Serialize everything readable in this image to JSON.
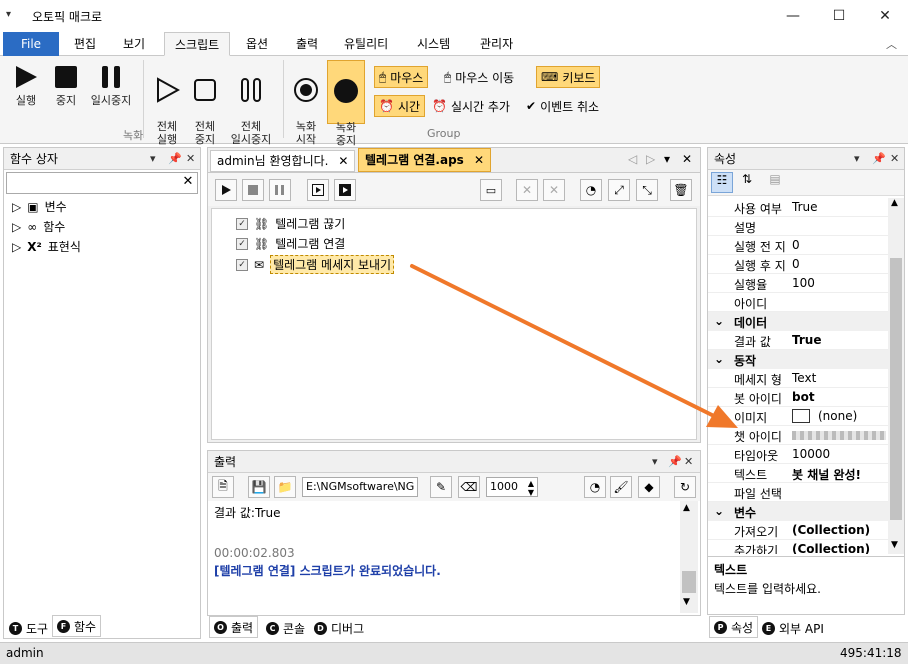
{
  "window": {
    "title": "오토픽 매크로"
  },
  "menu_tabs": [
    "File",
    "편집",
    "보기",
    "스크립트",
    "옵션",
    "출력",
    "유틸리티",
    "시스템",
    "관리자"
  ],
  "ribbon": {
    "play": "실행",
    "stop": "중지",
    "pause": "일시중지",
    "all_play": "전체\n실행",
    "all_stop": "전체\n중지",
    "all_pause": "전체\n일시중지",
    "rec_start": "녹화\n시작",
    "rec_stop": "녹화\n중지",
    "mouse": "마우스",
    "mouse_move": "마우스 이동",
    "keyboard": "키보드",
    "time": "시간",
    "realtime_add": "실시간 추가",
    "event_cancel": "이벤트 취소",
    "group_rec": "녹화",
    "group_group": "Group"
  },
  "left_panel": {
    "title": "함수 상자",
    "items": [
      "변수",
      "함수",
      "표현식"
    ],
    "bottom_tabs": [
      "도구",
      "함수"
    ]
  },
  "doc_tabs": [
    "admin님 환영합니다.",
    "텔레그램 연결.aps"
  ],
  "script_items": [
    "텔레그램 끊기",
    "텔레그램 연결",
    "텔레그램 메세지 보내기"
  ],
  "output": {
    "title": "출력",
    "path": "E:\\NGMsoftware\\NG",
    "count": "1000",
    "lines": [
      "결과 값:True",
      "",
      "",
      "00:00:02.803",
      "[텔레그램 연결] 스크립트가 완료되었습니다."
    ],
    "bottom_tabs": [
      "출력",
      "콘솔",
      "디버그"
    ]
  },
  "properties": {
    "title": "속성",
    "rows": [
      {
        "k": "사용 여부",
        "v": "True"
      },
      {
        "k": "설명",
        "v": ""
      },
      {
        "k": "실행 전 지",
        "v": "0"
      },
      {
        "k": "실행 후 지",
        "v": "0"
      },
      {
        "k": "실행율",
        "v": "100"
      },
      {
        "k": "아이디",
        "v": ""
      }
    ],
    "cat_data": "데이터",
    "data_rows": [
      {
        "k": "결과 값",
        "v": "True"
      }
    ],
    "cat_action": "동작",
    "action_rows": [
      {
        "k": "메세지 형",
        "v": "Text"
      },
      {
        "k": "봇 아이디",
        "v": "bot"
      },
      {
        "k": "이미지",
        "v": "(none)"
      },
      {
        "k": "챗 아이디",
        "v": ""
      },
      {
        "k": "타임아웃",
        "v": "10000"
      },
      {
        "k": "텍스트",
        "v": "봇 채널 완성!"
      },
      {
        "k": "파일 선택",
        "v": ""
      }
    ],
    "cat_var": "변수",
    "var_rows": [
      {
        "k": "가져오기",
        "v": "(Collection)"
      },
      {
        "k": "추가하기",
        "v": "(Collection)"
      }
    ],
    "desc_title": "텍스트",
    "desc_text": "텍스트를 입력하세요.",
    "bottom_tabs": [
      "속성",
      "외부 API"
    ]
  },
  "status": {
    "user": "admin",
    "coords": "495:41:18"
  },
  "colors": {
    "accent": "#2b6cc4",
    "highlight": "#ffd87a",
    "arrow": "#f0782a"
  }
}
